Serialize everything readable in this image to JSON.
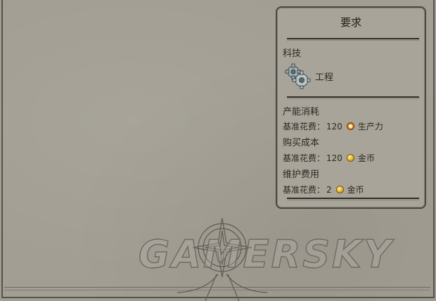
{
  "panel": {
    "title": "要求",
    "tech_section": "科技",
    "tech_item": {
      "icon": "gears-icon",
      "label": "工程"
    },
    "production_section": "产能消耗",
    "production_row": {
      "label": "基准花费：",
      "value": "120",
      "icon": "production-icon",
      "unit": "生产力"
    },
    "purchase_section": "购买成本",
    "purchase_row": {
      "label": "基准花费：",
      "value": "120",
      "icon": "gold-coin-icon",
      "unit": "金币"
    },
    "upkeep_section": "维护费用",
    "upkeep_row": {
      "label": "基准花费：",
      "value": "2",
      "icon": "gold-coin-icon",
      "unit": "金币"
    }
  },
  "watermark": {
    "text": "GAMERSKY"
  },
  "colors": {
    "background": "#a29e93",
    "panel": "#a9a499",
    "frame": "#4a4842",
    "gold": "#e2b52a",
    "production": "#e89a2c"
  }
}
